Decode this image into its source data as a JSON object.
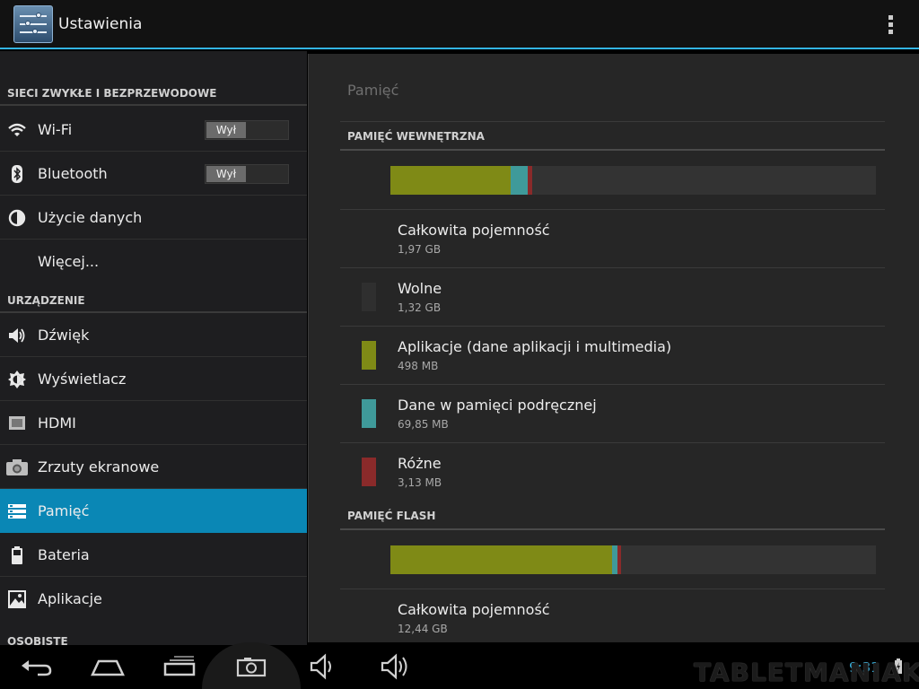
{
  "app": {
    "title": "Ustawienia",
    "icon": "settings-sliders-icon",
    "accent_color": "#33b5e5"
  },
  "sidebar": {
    "sections": [
      {
        "header": "SIECI ZWYKŁE I BEZPRZEWODOWE"
      },
      {
        "header": "URZĄDZENIE"
      },
      {
        "header": "OSOBISTE"
      }
    ],
    "items": [
      {
        "label": "Wi-Fi",
        "icon": "wifi-icon",
        "toggle": "Wył"
      },
      {
        "label": "Bluetooth",
        "icon": "bluetooth-icon",
        "toggle": "Wył"
      },
      {
        "label": "Użycie danych",
        "icon": "data-usage-icon"
      },
      {
        "label": "Więcej...",
        "icon": ""
      },
      {
        "label": "Dźwięk",
        "icon": "speaker-icon"
      },
      {
        "label": "Wyświetlacz",
        "icon": "brightness-icon"
      },
      {
        "label": "HDMI",
        "icon": "hdmi-icon"
      },
      {
        "label": "Zrzuty ekranowe",
        "icon": "camera-icon"
      },
      {
        "label": "Pamięć",
        "icon": "storage-icon",
        "selected": true
      },
      {
        "label": "Bateria",
        "icon": "battery-icon"
      },
      {
        "label": "Aplikacje",
        "icon": "apps-icon"
      }
    ],
    "selected_color": "#0a87b5"
  },
  "storage": {
    "title": "Pamięć",
    "internal": {
      "header": "PAMIĘĆ WEWNĘTRZNA",
      "usage_fractions": {
        "apps": 0.247,
        "cache": 0.035,
        "misc": 0.009
      },
      "total": {
        "label": "Całkowita pojemność",
        "value": "1,97 GB"
      },
      "rows": [
        {
          "label": "Wolne",
          "value": "1,32 GB",
          "color": "#2f2f2f"
        },
        {
          "label": "Aplikacje (dane aplikacji i multimedia)",
          "value": "498 MB",
          "color": "#7f8a16"
        },
        {
          "label": "Dane w pamięci podręcznej",
          "value": "69,85 MB",
          "color": "#3f9a9a"
        },
        {
          "label": "Różne",
          "value": "3,13 MB",
          "color": "#8a2a2a"
        }
      ]
    },
    "flash": {
      "header": "PAMIĘĆ FLASH",
      "usage_fractions": {
        "apps": 0.456,
        "cache": 0.011,
        "misc": 0.008
      },
      "total": {
        "label": "Całkowita pojemność",
        "value": "12,44 GB"
      }
    }
  },
  "navbar": {
    "buttons": [
      "back-icon",
      "home-icon",
      "recent-apps-icon",
      "screenshot-icon",
      "volume-down-icon",
      "volume-up-icon"
    ],
    "clock": "9:31",
    "battery": "battery-charging-icon"
  },
  "watermark": "TABLETMANIAK"
}
